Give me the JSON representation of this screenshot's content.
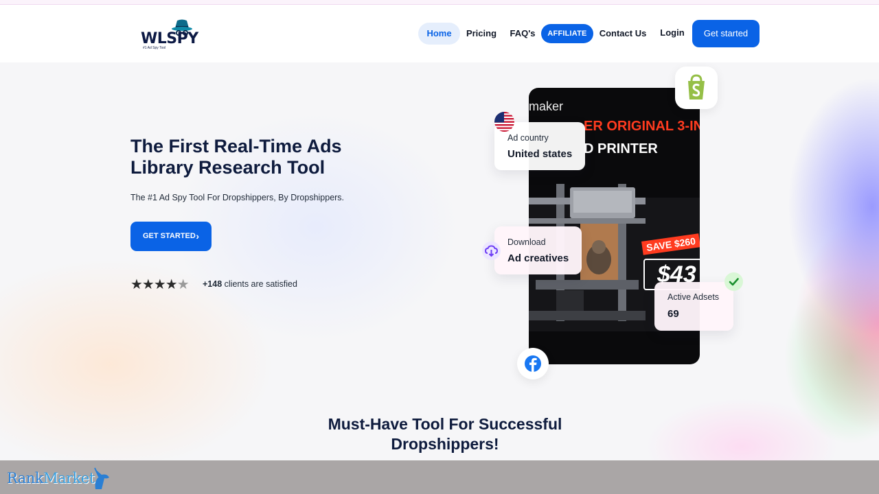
{
  "brand": {
    "logo_text": "WLSPY",
    "tagline": "#1 Ad Spy Tool"
  },
  "nav": {
    "home": "Home",
    "pricing": "Pricing",
    "faq": "FAQ's",
    "affiliate": "AFFILIATE",
    "contact": "Contact Us",
    "login": "Login",
    "get_started": "Get started"
  },
  "hero": {
    "title": "The First Real-Time Ads Library Research Tool",
    "subtitle": "The #1 Ad Spy Tool For Dropshippers, By Dropshippers.",
    "cta": "GET STARTED",
    "rating_value": 4.5,
    "rating_max": 5,
    "clients_count": "+148",
    "clients_text": "clients are satisfied"
  },
  "ad_preview": {
    "brand": "maker",
    "headline_line1_red": "ER ORIGINAL 3-IN",
    "headline_line2": "D PRINTER",
    "save_text": "SAVE $260",
    "price_text": "$43"
  },
  "cards": {
    "country_label": "Ad country",
    "country_value": "United states",
    "download_label": "Download",
    "download_value": "Ad creatives",
    "adsets_label": "Active Adsets",
    "adsets_value": "69"
  },
  "section": {
    "title": "Must-Have Tool For Successful Dropshippers!"
  },
  "watermark": {
    "rank": "Rank",
    "market": "Market"
  },
  "colors": {
    "primary": "#0a63e6",
    "navy": "#0e1b3d",
    "shopify_green": "#95bf47",
    "facebook_blue": "#1877f2"
  },
  "icons": [
    "spy-hat-icon",
    "chevron-right-icon",
    "star-icon",
    "shopify-icon",
    "us-flag-icon",
    "download-icon",
    "check-icon",
    "facebook-icon",
    "unicorn-icon"
  ]
}
